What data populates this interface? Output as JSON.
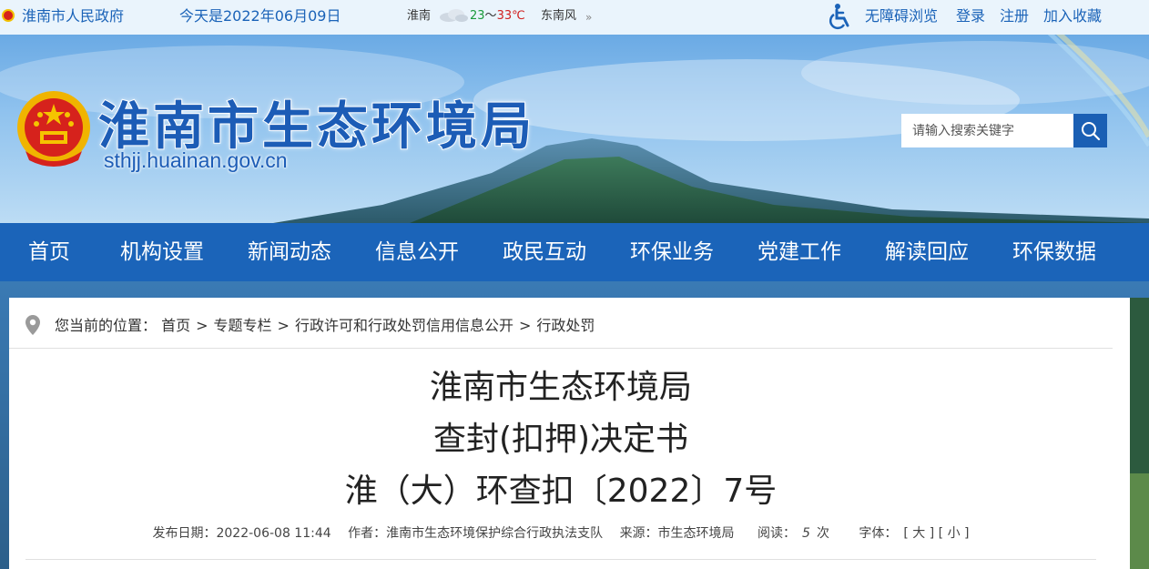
{
  "topbar": {
    "gov_name": "淮南市人民政府",
    "date_text": "今天是2022年06月09日",
    "weather": {
      "city": "淮南",
      "temp_low": "23",
      "temp_sep": "～",
      "temp_high": "33℃",
      "wind": "东南风",
      "more_icon": "»"
    },
    "links": [
      "无障碍浏览",
      "登录",
      "注册",
      "加入收藏"
    ]
  },
  "header": {
    "site_title": "淮南市生态环境局",
    "site_url": "sthjj.huainan.gov.cn",
    "search_placeholder": "请输入搜索关键字"
  },
  "nav": {
    "items": [
      "首页",
      "机构设置",
      "新闻动态",
      "信息公开",
      "政民互动",
      "环保业务",
      "党建工作",
      "解读回应",
      "环保数据"
    ]
  },
  "breadcrumb": {
    "prefix": "您当前的位置：",
    "items": [
      "首页",
      "专题专栏",
      "行政许可和行政处罚信用信息公开",
      "行政处罚"
    ],
    "separator": ">"
  },
  "article": {
    "title_lines": [
      "淮南市生态环境局",
      "查封(扣押)决定书",
      "淮（大）环查扣〔2022〕7号"
    ],
    "meta": {
      "publish_date": "发布日期：2022-06-08 11:44",
      "author": "作者：淮南市生态环境保护综合行政执法支队",
      "source": "来源：市生态环境局",
      "reads_label": "阅读：",
      "reads_count": "5",
      "reads_unit": "次",
      "font_label": "字体：",
      "font_large": "[ 大 ]",
      "font_small": "[ 小 ]"
    }
  },
  "colors": {
    "primary": "#1b64b9",
    "topbar_bg": "#eaf4fc",
    "link": "#1b63b8"
  }
}
